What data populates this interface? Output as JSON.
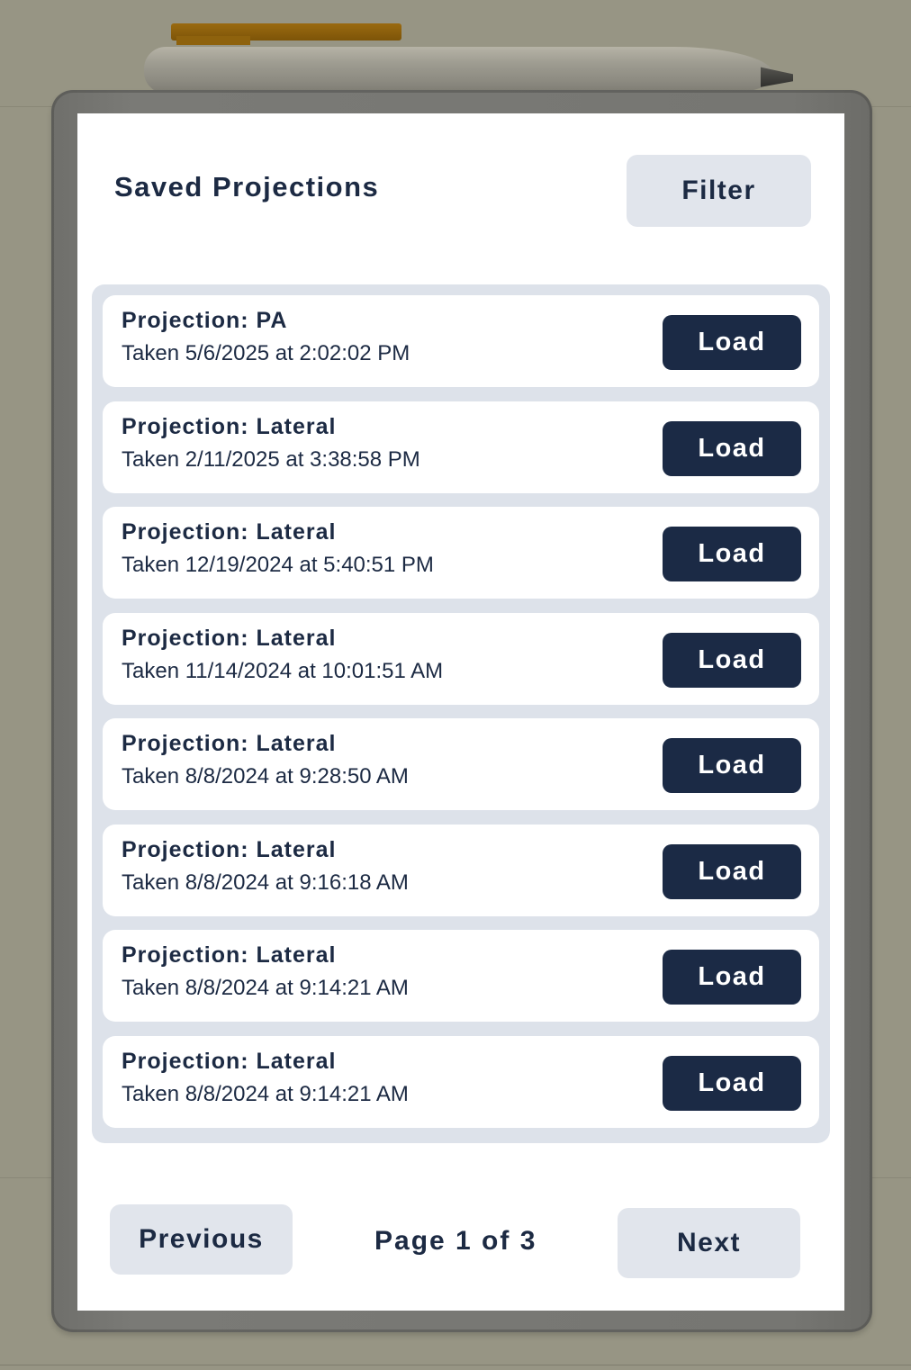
{
  "header": {
    "title": "Saved Projections",
    "filter_label": "Filter"
  },
  "projections": [
    {
      "title": "Projection: PA",
      "taken": "Taken 5/6/2025 at 2:02:02 PM",
      "action": "Load"
    },
    {
      "title": "Projection: Lateral",
      "taken": "Taken 2/11/2025 at 3:38:58 PM",
      "action": "Load"
    },
    {
      "title": "Projection: Lateral",
      "taken": "Taken 12/19/2024 at 5:40:51 PM",
      "action": "Load"
    },
    {
      "title": "Projection: Lateral",
      "taken": "Taken 11/14/2024 at 10:01:51 AM",
      "action": "Load"
    },
    {
      "title": "Projection: Lateral",
      "taken": "Taken 8/8/2024 at 9:28:50 AM",
      "action": "Load"
    },
    {
      "title": "Projection: Lateral",
      "taken": "Taken 8/8/2024 at 9:16:18 AM",
      "action": "Load"
    },
    {
      "title": "Projection: Lateral",
      "taken": "Taken 8/8/2024 at 9:14:21 AM",
      "action": "Load"
    },
    {
      "title": "Projection: Lateral",
      "taken": "Taken 8/8/2024 at 9:14:21 AM",
      "action": "Load"
    }
  ],
  "pagination": {
    "previous_label": "Previous",
    "page_label": "Page 1 of 3",
    "next_label": "Next"
  },
  "colors": {
    "primary": "#1b2a45",
    "panel": "#dde2ea",
    "light_button": "#e1e5ec"
  }
}
